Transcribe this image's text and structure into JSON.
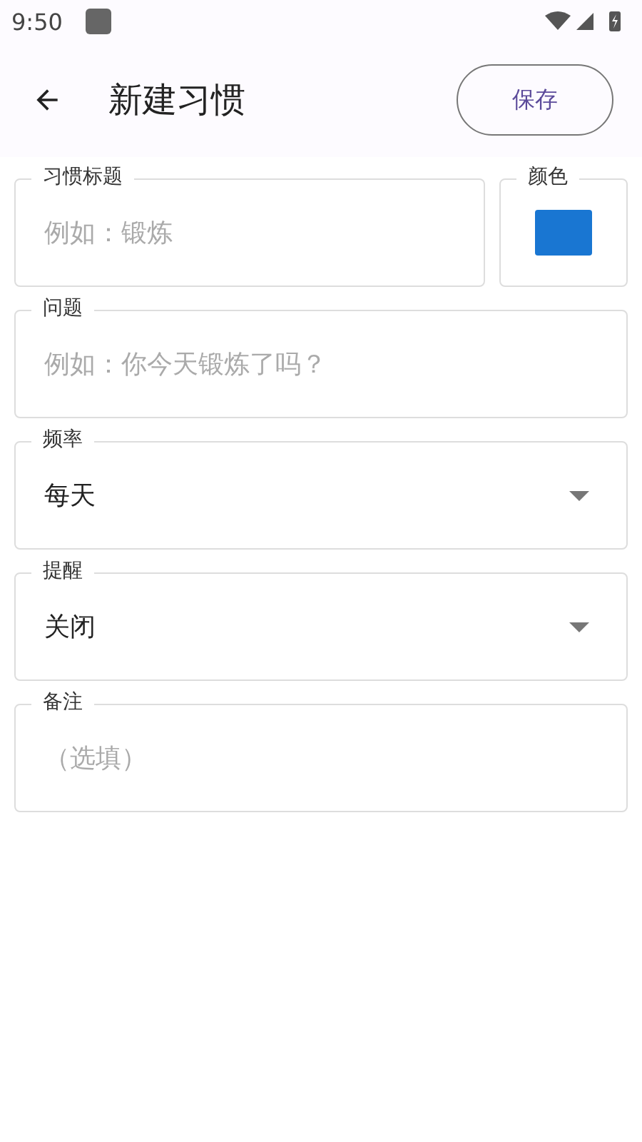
{
  "status_bar": {
    "time": "9:50"
  },
  "app_bar": {
    "title": "新建习惯",
    "action": "保存"
  },
  "rows": [
    [
      {
        "kind": "text",
        "label": "习惯标题",
        "placeholder": "例如：锻炼"
      },
      {
        "kind": "color",
        "label": "颜色",
        "color": "#1976d2"
      }
    ],
    [
      {
        "kind": "text",
        "label": "问题",
        "placeholder": "例如：你今天锻炼了吗？"
      }
    ],
    [
      {
        "kind": "select",
        "label": "频率",
        "value": "每天"
      }
    ],
    [
      {
        "kind": "select",
        "label": "提醒",
        "value": "关闭"
      }
    ],
    [
      {
        "kind": "text",
        "label": "备注",
        "placeholder": "（选填）"
      }
    ]
  ]
}
